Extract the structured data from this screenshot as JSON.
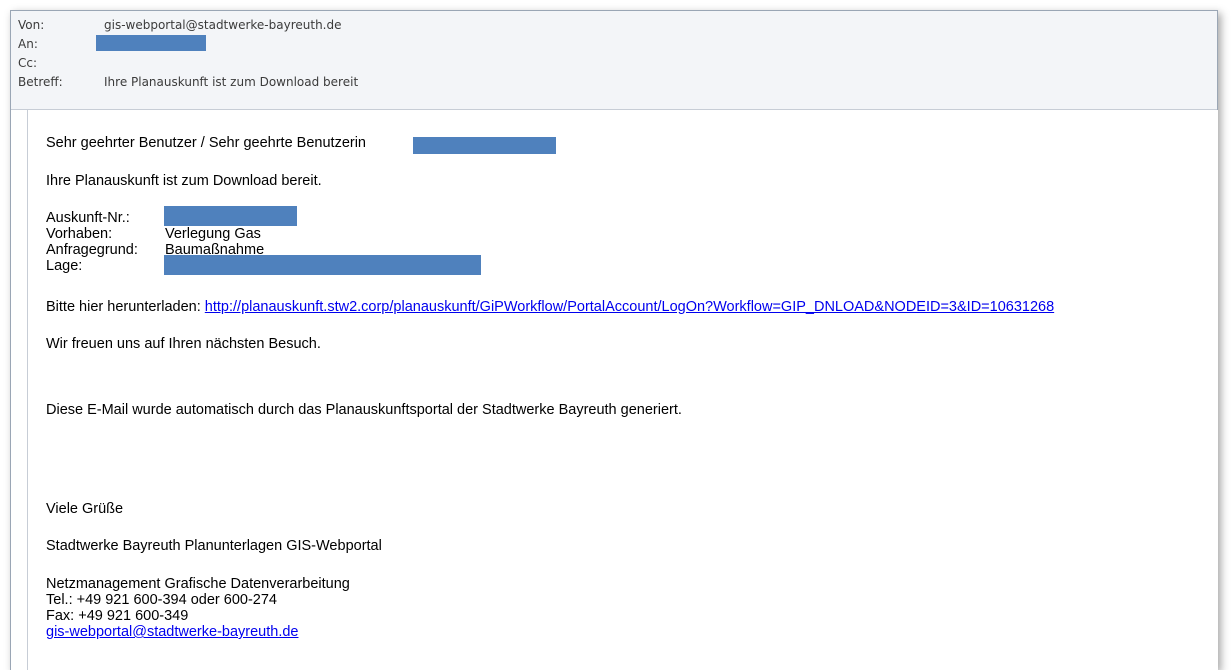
{
  "header": {
    "from_label": "Von:",
    "from_value": "gis-webportal@stadtwerke-bayreuth.de",
    "to_label": "An:",
    "cc_label": "Cc:",
    "subject_label": "Betreff:",
    "subject_value": "Ihre Planauskunft ist zum Download bereit"
  },
  "message": {
    "greeting": "Sehr geehrter Benutzer / Sehr geehrte Benutzerin",
    "intro": "Ihre Planauskunft ist zum Download bereit.",
    "details": {
      "auskunft_label": "Auskunft-Nr.:",
      "vorhaben_label": "Vorhaben:",
      "vorhaben_value": "Verlegung Gas",
      "anfragegrund_label": "Anfragegrund:",
      "anfragegrund_value": "Baumaßnahme",
      "lage_label": "Lage:"
    },
    "download_prefix": "Bitte hier herunterladen:",
    "download_link": "http://planauskunft.stw2.corp/planauskunft/GiPWorkflow/PortalAccount/LogOn?Workflow=GIP_DNLOAD&NODEID=3&ID=10631268",
    "visit": "Wir freuen uns auf Ihren nächsten Besuch.",
    "auto_note": "Diese E-Mail wurde automatisch durch das Planauskunftsportal der Stadtwerke Bayreuth generiert.",
    "closing": "Viele Grüße",
    "sender_org": "Stadtwerke Bayreuth Planunterlagen GIS-Webportal",
    "dept": "Netzmanagement Grafische Datenverarbeitung",
    "tel": "Tel.: +49 921 600-394 oder 600-274",
    "fax": "Fax: +49 921 600-349",
    "email_link": "gis-webportal@stadtwerke-bayreuth.de"
  },
  "colors": {
    "redaction": "#4f81bd",
    "link": "#0000ee",
    "header_bg": "#f3f5f8"
  }
}
